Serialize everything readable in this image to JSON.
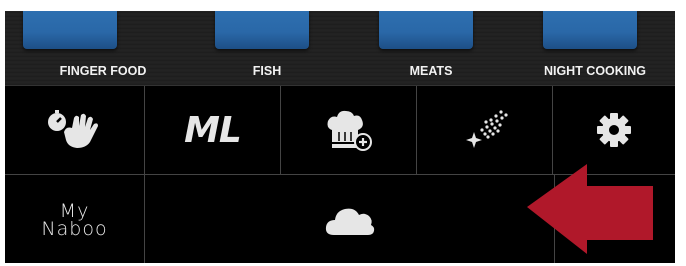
{
  "categories": [
    {
      "label": "FINGER FOOD"
    },
    {
      "label": "FISH"
    },
    {
      "label": "MEATS"
    },
    {
      "label": "NIGHT COOKING"
    }
  ],
  "toolbar": {
    "items": [
      {
        "icon": "timer-hand-icon"
      },
      {
        "label": "ML",
        "icon": "ml-icon"
      },
      {
        "icon": "chef-hat-add-icon"
      },
      {
        "icon": "spray-clean-icon"
      },
      {
        "icon": "gear-icon"
      }
    ]
  },
  "bottom": {
    "logo": {
      "line1": "My",
      "line2": "Naboo"
    },
    "cloud_icon": "cloud-icon",
    "arrow_icon": "arrow-left-icon"
  },
  "colors": {
    "tile_blue": "#2a68a8",
    "arrow_red": "#b0182a",
    "icon_fg": "#e6e6e6"
  }
}
